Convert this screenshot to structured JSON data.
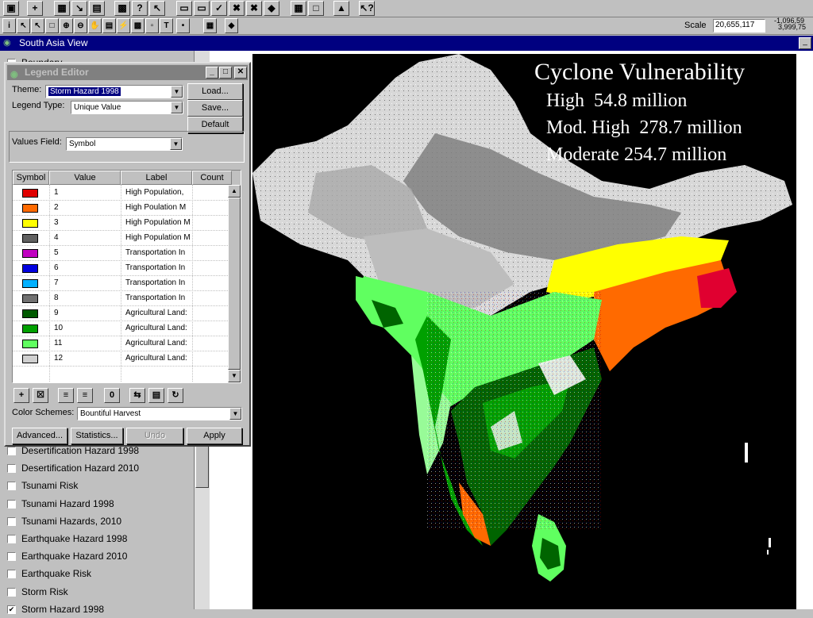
{
  "toolbar": {
    "row1_icons": [
      "save-icon",
      "add-theme-icon",
      "theme-properties-icon",
      "edit-legend-icon",
      "attribute-table-icon",
      "query-builder-icon",
      "locate-icon",
      "select-by-theme-icon",
      "zoom-full-icon",
      "zoom-active-icon",
      "zoom-selected-icon",
      "zoom-in-fixed-icon",
      "zoom-out-fixed-icon",
      "zoom-previous-icon",
      "layout-icon",
      "help-icon",
      "lightning-icon",
      "context-help-icon"
    ],
    "row2_icons": [
      "identify-icon",
      "pointer-icon",
      "vertex-edit-icon",
      "select-feature-icon",
      "zoom-in-icon",
      "zoom-out-icon",
      "pan-icon",
      "measure-icon",
      "hotlink-icon",
      "area-of-interest-icon",
      "label-icon",
      "text-icon",
      "draw-point-icon",
      "snap-icon",
      "network-icon"
    ],
    "scale_label": "Scale",
    "scale_value": "20,655,117",
    "coord_x": "-1,096,59",
    "coord_y": "3,999,75"
  },
  "view": {
    "title": "South Asia View"
  },
  "toc": {
    "partial_top_item": "Boundary",
    "items": [
      {
        "label": "Desertification Hazard 1998",
        "checked": false
      },
      {
        "label": "Desertification Hazard 2010",
        "checked": false
      },
      {
        "label": "Tsunami Risk",
        "checked": false
      },
      {
        "label": "Tsunami Hazard 1998",
        "checked": false
      },
      {
        "label": "Tsunami Hazards, 2010",
        "checked": false
      },
      {
        "label": "Earthquake Hazard 1998",
        "checked": false
      },
      {
        "label": "Earthquake Hazard 2010",
        "checked": false
      },
      {
        "label": "Earthquake Risk",
        "checked": false
      },
      {
        "label": "Storm Risk",
        "checked": false
      },
      {
        "label": "Storm Hazard 1998",
        "checked": true
      }
    ]
  },
  "map": {
    "title": "Cyclone Vulnerability",
    "lines": [
      "High  54.8 million",
      "Mod. High  278.7 million",
      "Moderate 254.7 million"
    ]
  },
  "legend_editor": {
    "title": "Legend Editor",
    "theme_label": "Theme:",
    "theme_value": "Storm Hazard 1998",
    "legend_type_label": "Legend Type:",
    "legend_type_value": "Unique Value",
    "values_field_label": "Values Field:",
    "values_field_value": "Symbol",
    "buttons": {
      "load": "Load...",
      "save": "Save...",
      "default": "Default",
      "advanced": "Advanced...",
      "statistics": "Statistics...",
      "undo": "Undo",
      "apply": "Apply"
    },
    "columns": [
      "Symbol",
      "Value",
      "Label",
      "Count"
    ],
    "rows": [
      {
        "color": "#e00000",
        "value": "1",
        "label": "High Population,"
      },
      {
        "color": "#ff6a00",
        "value": "2",
        "label": "High Poulation M"
      },
      {
        "color": "#ffff00",
        "value": "3",
        "label": "High Population M"
      },
      {
        "color": "#606060",
        "value": "4",
        "label": "High Population M"
      },
      {
        "color": "#c000c0",
        "value": "5",
        "label": "Transportation In"
      },
      {
        "color": "#0000e0",
        "value": "6",
        "label": "Transportation In"
      },
      {
        "color": "#00b0ff",
        "value": "7",
        "label": "Transportation In"
      },
      {
        "color": "#707070",
        "value": "8",
        "label": "Transportation In"
      },
      {
        "color": "#005a00",
        "value": "9",
        "label": "Agricultural Land:"
      },
      {
        "color": "#00a000",
        "value": "10",
        "label": "Agricultural Land:"
      },
      {
        "color": "#60ff60",
        "value": "11",
        "label": "Agricultural Land:"
      },
      {
        "color": "#d0d0d0",
        "value": "12",
        "label": "Agricultural Land:"
      }
    ],
    "tool_icons": [
      "add-class-icon",
      "delete-class-icon",
      "sort-ascending-icon",
      "sort-descending-icon",
      "null-value-icon",
      "reverse-order-icon",
      "copy-icon",
      "paste-icon"
    ],
    "color_schemes_label": "Color Schemes:",
    "color_schemes_value": "Bountiful Harvest"
  },
  "colors": {
    "titlebar_active": "#000080",
    "titlebar_inactive": "#808080",
    "face": "#c0c0c0",
    "map_background": "#000000"
  }
}
